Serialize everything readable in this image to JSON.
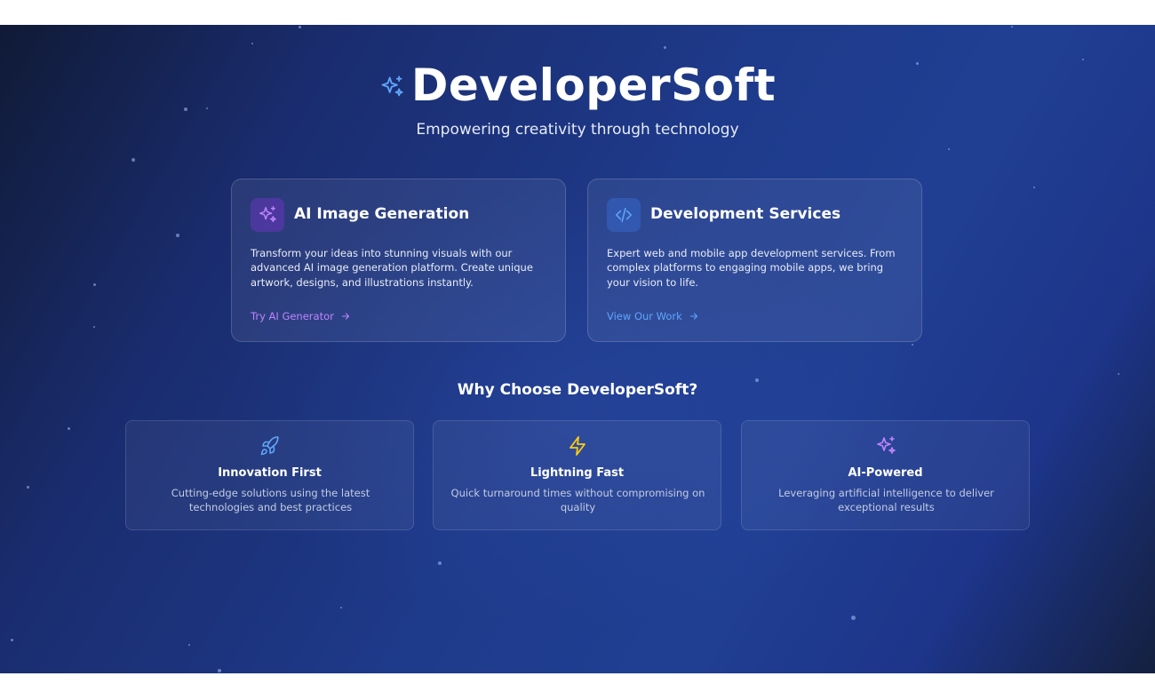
{
  "brand": {
    "title": "DeveloperSoft",
    "subtitle": "Empowering creativity through technology",
    "icon": "sparkles-icon"
  },
  "services": [
    {
      "title": "AI Image Generation",
      "description": "Transform your ideas into stunning visuals with our advanced AI image generation platform. Create unique artwork, designs, and illustrations instantly.",
      "link_label": "Try AI Generator",
      "icon": "sparkles-icon",
      "accent": "#c084fc"
    },
    {
      "title": "Development Services",
      "description": "Expert web and mobile app development services. From complex platforms to engaging mobile apps, we bring your vision to life.",
      "link_label": "View Our Work",
      "icon": "code-icon",
      "accent": "#60a5fa"
    }
  ],
  "why": {
    "title": "Why Choose DeveloperSoft?",
    "features": [
      {
        "title": "Innovation First",
        "description": "Cutting-edge solutions using the latest technologies and best practices",
        "icon": "rocket-icon",
        "color": "#60a5fa"
      },
      {
        "title": "Lightning Fast",
        "description": "Quick turnaround times without compromising on quality",
        "icon": "lightning-icon",
        "color": "#facc15"
      },
      {
        "title": "AI-Powered",
        "description": "Leveraging artificial intelligence to deliver exceptional results",
        "icon": "sparkles-icon",
        "color": "#c084fc"
      }
    ]
  },
  "colors": {
    "background_start": "#101a36",
    "background_mid": "#1e3a8a",
    "background_end": "#14203f",
    "link_purple": "#c084fc",
    "link_blue": "#60a5fa"
  }
}
